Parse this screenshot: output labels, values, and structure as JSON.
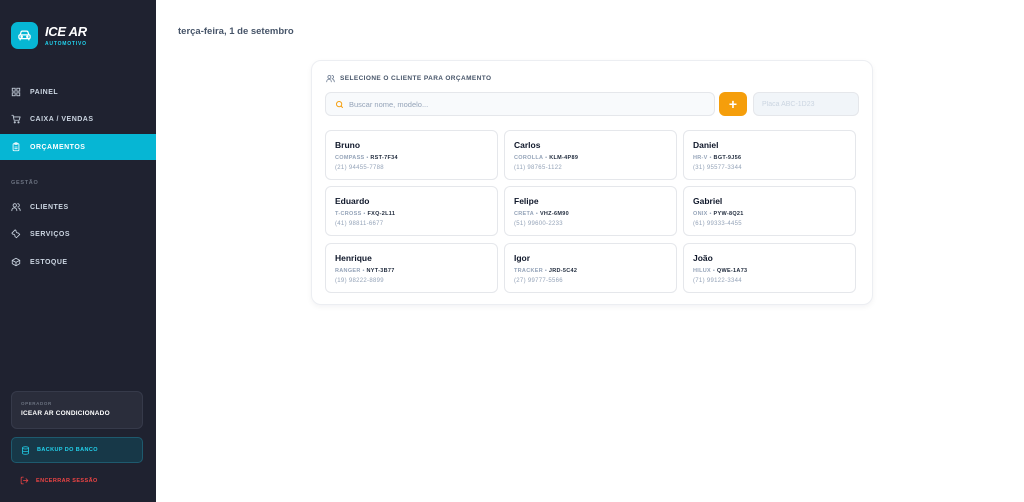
{
  "brand": {
    "name": "ICE AR",
    "subtitle": "AUTOMOTIVO"
  },
  "nav": {
    "painel": "PAINEL",
    "caixa": "CAIXA / VENDAS",
    "orcamentos": "ORÇAMENTOS",
    "section_gestao": "GESTÃO",
    "clientes": "CLIENTES",
    "servicos": "SERVIÇOS",
    "estoque": "ESTOQUE"
  },
  "operator": {
    "label": "OPERADOR",
    "name": "ICEAR AR CONDICIONADO"
  },
  "backup_label": "BACKUP DO BANCO",
  "logout_label": "ENCERRAR SESSÃO",
  "date": "terça-feira, 1 de setembro",
  "panel": {
    "title": "SELECIONE O CLIENTE PARA ORÇAMENTO",
    "search_placeholder": "Buscar nome, modelo...",
    "add_label": "+",
    "plate_placeholder": "Placa ABC-1D23"
  },
  "clients": [
    {
      "name": "Bruno",
      "model": "COMPASS",
      "plate": "RST-7F34",
      "phone": "(21) 94455-7788"
    },
    {
      "name": "Carlos",
      "model": "COROLLA",
      "plate": "KLM-4P89",
      "phone": "(11) 98765-1122"
    },
    {
      "name": "Daniel",
      "model": "HR-V",
      "plate": "BGT-9J56",
      "phone": "(31) 95577-3344"
    },
    {
      "name": "Eduardo",
      "model": "T-CROSS",
      "plate": "FXQ-2L11",
      "phone": "(41) 98811-6677"
    },
    {
      "name": "Felipe",
      "model": "CRETA",
      "plate": "VHZ-6M90",
      "phone": "(51) 99600-2233"
    },
    {
      "name": "Gabriel",
      "model": "ONIX",
      "plate": "PYW-8Q21",
      "phone": "(61) 99333-4455"
    },
    {
      "name": "Henrique",
      "model": "RANGER",
      "plate": "NYT-3B77",
      "phone": "(19) 98222-8899"
    },
    {
      "name": "Igor",
      "model": "TRACKER",
      "plate": "JRD-5C42",
      "phone": "(27) 99777-5566"
    },
    {
      "name": "João",
      "model": "HILUX",
      "plate": "QWE-1A73",
      "phone": "(71) 99122-3344"
    }
  ],
  "colors": {
    "accent": "#06b6d4",
    "sidebar": "#1f2230",
    "add_button": "#f59e0b",
    "danger": "#ef4444"
  }
}
